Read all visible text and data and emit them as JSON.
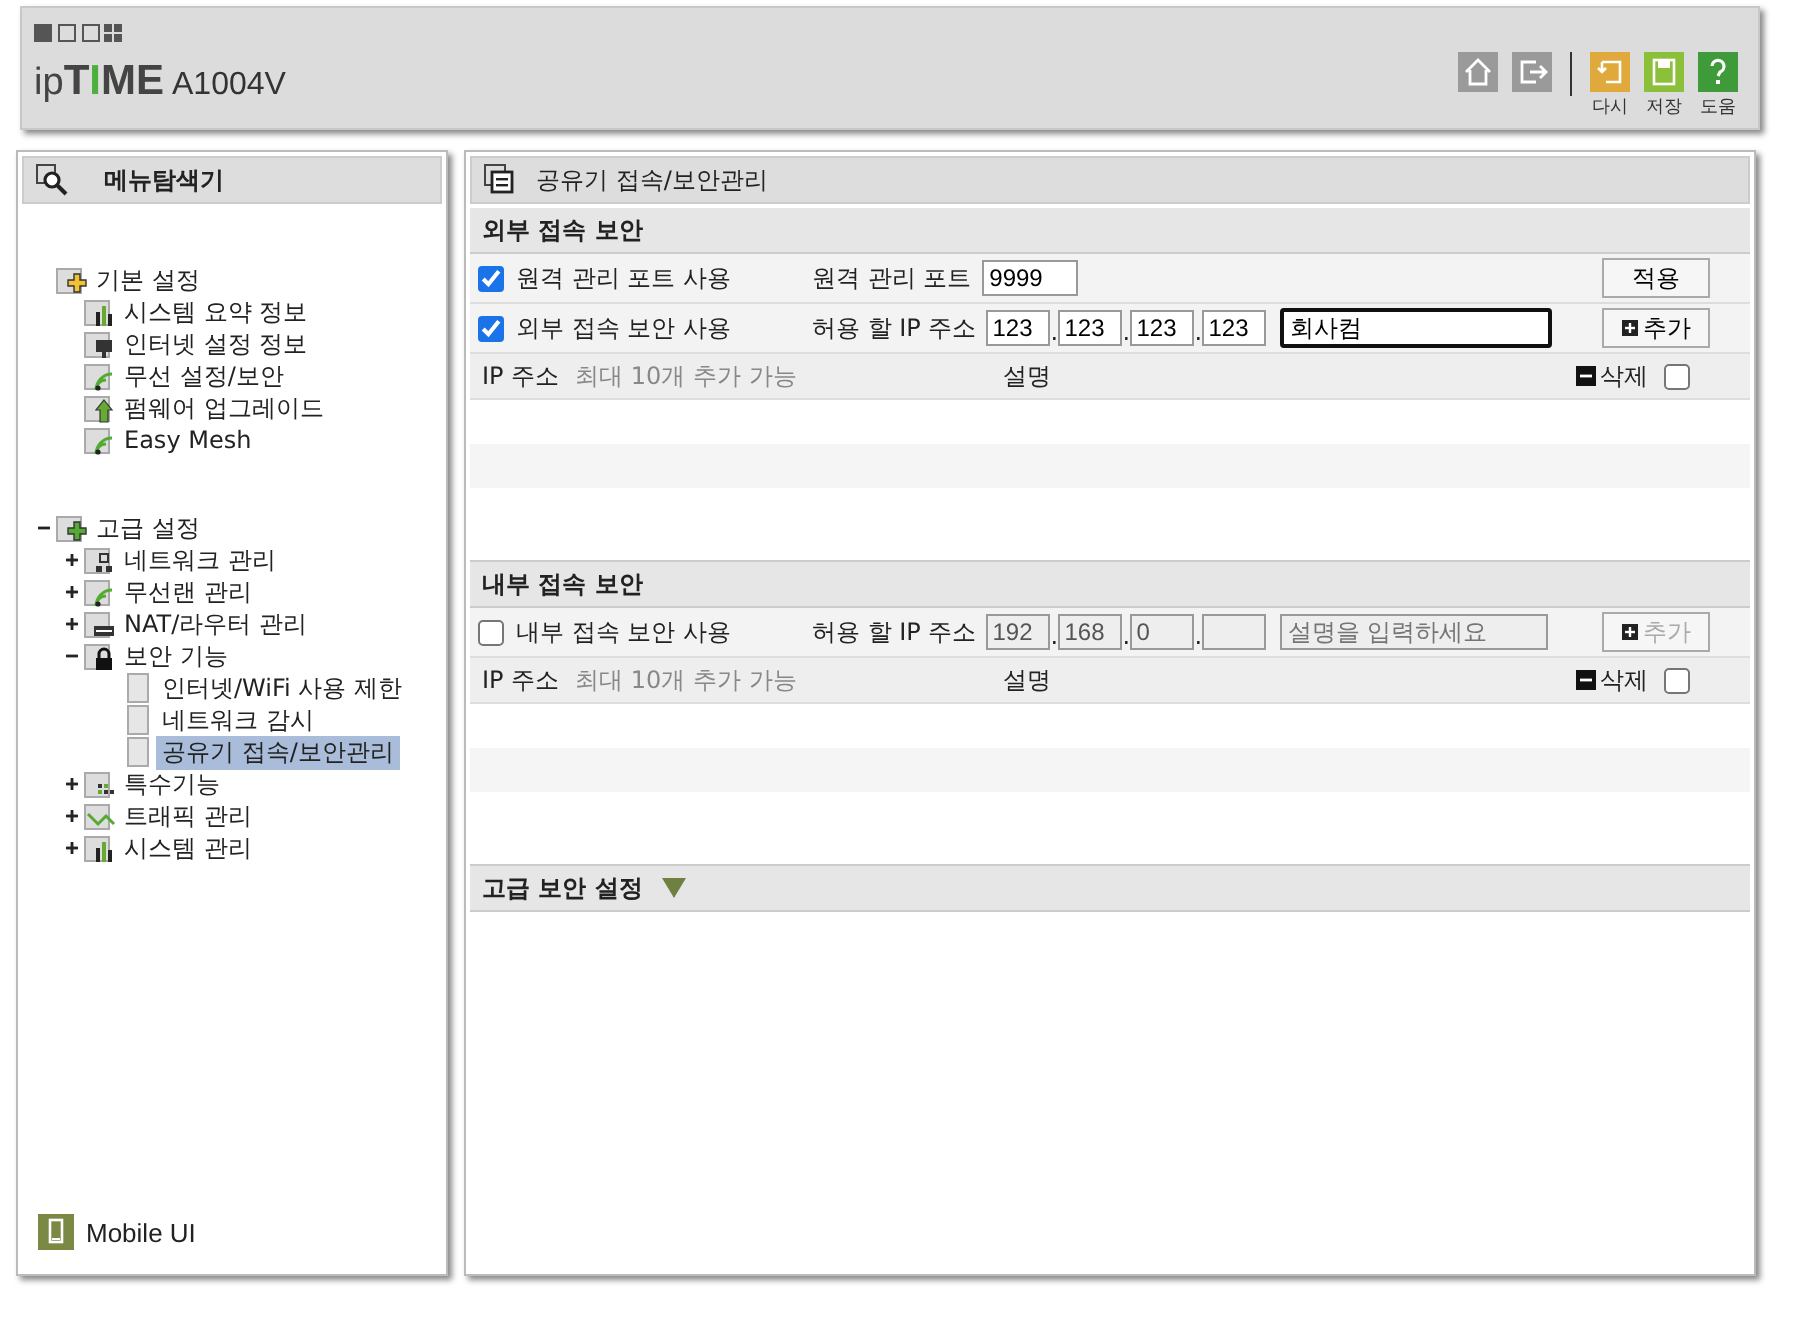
{
  "header": {
    "logo": "ipTIME",
    "model": "A1004V",
    "actions": [
      {
        "kind": "home"
      },
      {
        "kind": "logout"
      }
    ],
    "buttons": [
      {
        "kind": "reload",
        "label": "다시"
      },
      {
        "kind": "save",
        "label": "저장"
      },
      {
        "kind": "help",
        "label": "도움"
      }
    ]
  },
  "sidebar": {
    "title": "메뉴탐색기",
    "tree": [
      {
        "label": "기본 설정",
        "kind": "basic",
        "selected": false,
        "children": [
          {
            "label": "시스템 요약 정보",
            "kind": "chart",
            "selected": false
          },
          {
            "label": "인터넷 설정 정보",
            "kind": "monitor",
            "selected": false
          },
          {
            "label": "무선 설정/보안",
            "kind": "wifi",
            "selected": false
          },
          {
            "label": "펌웨어 업그레이드",
            "kind": "upgrade",
            "selected": false
          },
          {
            "label": "Easy Mesh",
            "kind": "wifi",
            "selected": false
          }
        ]
      },
      {
        "label": "고급 설정",
        "kind": "advanced",
        "selected": false,
        "expanded": true,
        "children": [
          {
            "label": "네트워크 관리",
            "kind": "network",
            "selected": false,
            "expanded": false
          },
          {
            "label": "무선랜 관리",
            "kind": "wifi",
            "selected": false,
            "expanded": false
          },
          {
            "label": "NAT/라우터 관리",
            "kind": "router",
            "selected": false,
            "expanded": false
          },
          {
            "label": "보안 기능",
            "kind": "lock",
            "selected": false,
            "expanded": true,
            "children": [
              {
                "label": "인터넷/WiFi 사용 제한",
                "kind": "page",
                "selected": false
              },
              {
                "label": "네트워크 감시",
                "kind": "page",
                "selected": false
              },
              {
                "label": "공유기 접속/보안관리",
                "kind": "page",
                "selected": true
              }
            ]
          },
          {
            "label": "특수기능",
            "kind": "grid",
            "selected": false,
            "expanded": false
          },
          {
            "label": "트래픽 관리",
            "kind": "traffic",
            "selected": false,
            "expanded": false
          },
          {
            "label": "시스템 관리",
            "kind": "chart",
            "selected": false,
            "expanded": false
          }
        ]
      }
    ],
    "mobile_link": "Mobile UI"
  },
  "main": {
    "title": "공유기 접속/보안관리",
    "sections": [
      {
        "title": "외부 접속 보안",
        "rows": [
          {
            "kind": "port",
            "checkbox": {
              "label": "원격 관리 포트 사용",
              "checked": true
            },
            "field_label": "원격 관리 포트",
            "value": "9999",
            "button": "적용"
          },
          {
            "kind": "ip",
            "checkbox": {
              "label": "외부 접속 보안 사용",
              "checked": true
            },
            "field_label": "허용 할 IP 주소",
            "octets": [
              "123",
              "123",
              "123",
              "123"
            ],
            "separator": ".",
            "description": "회사컴",
            "button": "추가",
            "disabled": false
          }
        ],
        "list_header": {
          "ip": "IP 주소",
          "hint": "최대 10개 추가 가능",
          "description": "설명",
          "delete": "삭제",
          "checked": false
        }
      },
      {
        "title": "내부 접속 보안",
        "rows": [
          {
            "kind": "ip",
            "checkbox": {
              "label": "내부 접속 보안 사용",
              "checked": false
            },
            "field_label": "허용 할 IP 주소",
            "octets": [
              "192",
              "168",
              "0"
            ],
            "separator": ".",
            "placeholder": "설명을 입력하세요",
            "button": "추가",
            "disabled": true
          }
        ],
        "list_header": {
          "ip": "IP 주소",
          "hint": "최대 10개 추가 가능",
          "description": "설명",
          "delete": "삭제",
          "checked": false
        }
      }
    ],
    "advanced": {
      "title": "고급 보안 설정",
      "expanded": false
    }
  }
}
